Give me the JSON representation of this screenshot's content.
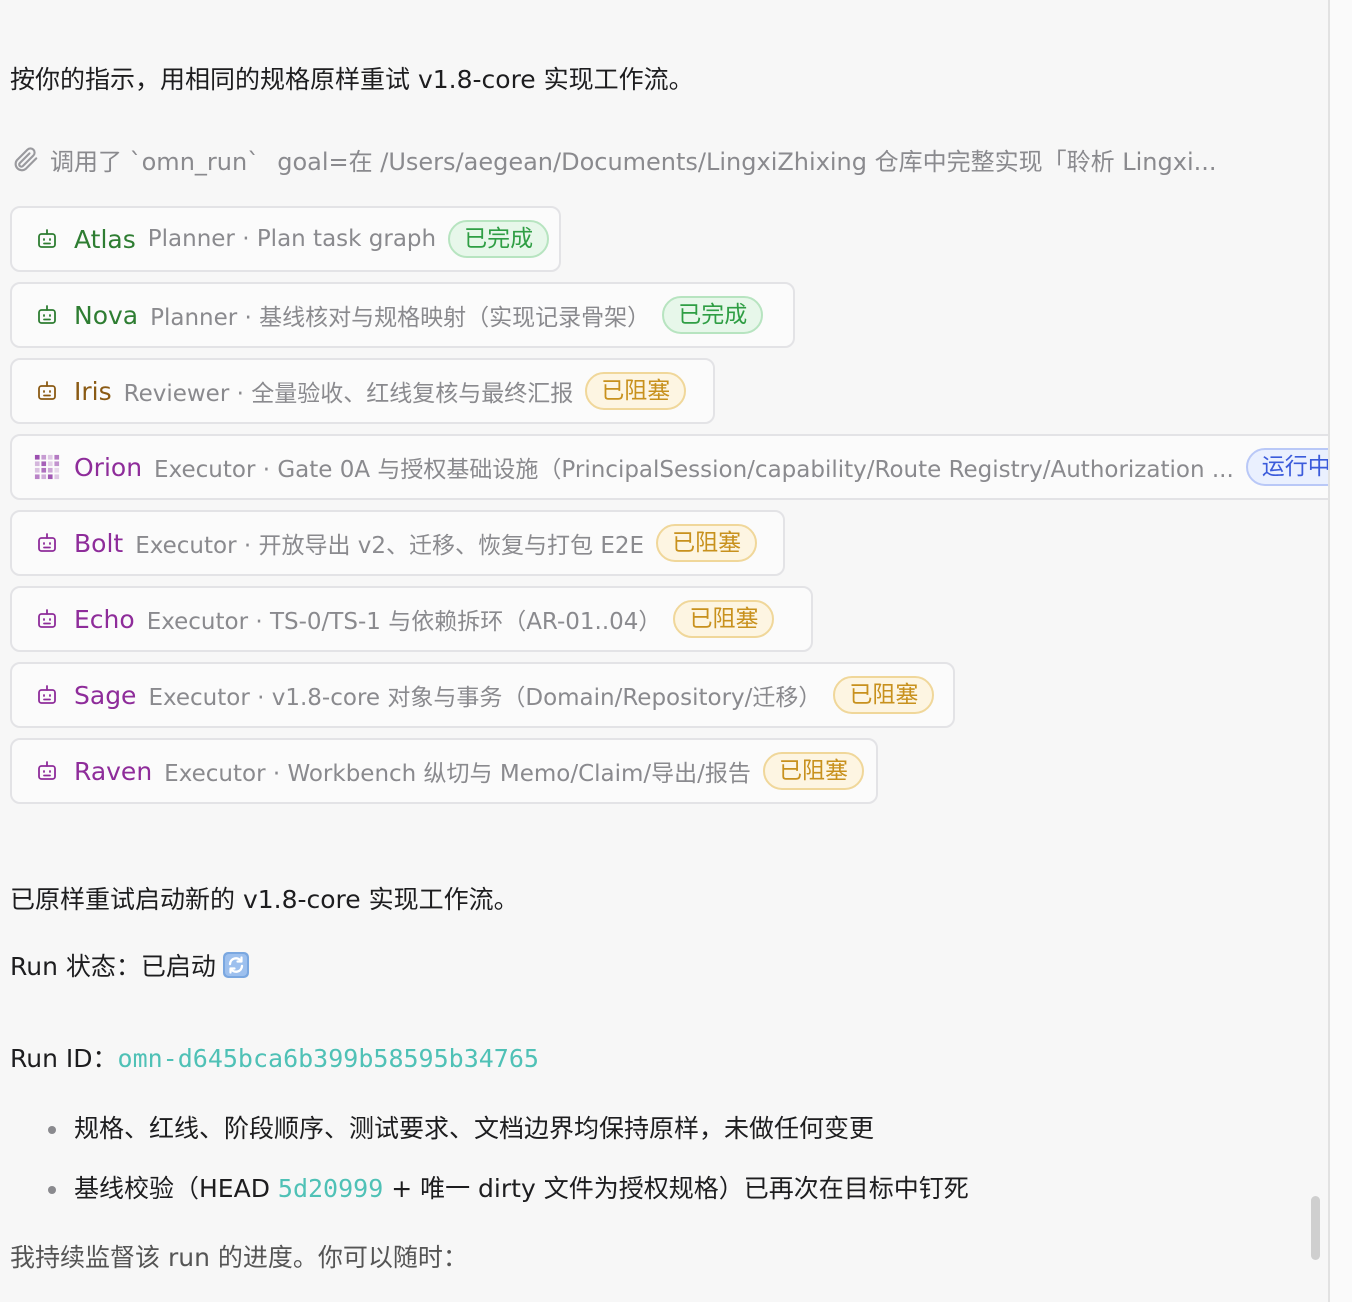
{
  "message": {
    "intro": "按你的指示，用相同的规格原样重试 v1.8-core 实现工作流。",
    "tool_call": {
      "label": "调用了 `omn_run`",
      "goal": "goal=在 /Users/aegean/Documents/LingxiZhixing 仓库中完整实现「聆析 Lingxi..."
    },
    "agents": [
      {
        "name": "Atlas",
        "desc": "Planner · Plan task graph",
        "status": "已完成",
        "state": "done",
        "color": "green",
        "icon": "robot-icon"
      },
      {
        "name": "Nova",
        "desc": "Planner · 基线核对与规格映射（实现记录骨架）",
        "status": "已完成",
        "state": "done",
        "color": "green",
        "icon": "robot-icon"
      },
      {
        "name": "Iris",
        "desc": "Reviewer · 全量验收、红线复核与最终汇报",
        "status": "已阻塞",
        "state": "blocked",
        "color": "brown",
        "icon": "robot-icon"
      },
      {
        "name": "Orion",
        "desc": "Executor · Gate 0A 与授权基础设施（PrincipalSession/capability/Route Registry/Authorization ...",
        "status": "运行中",
        "state": "running",
        "color": "purple",
        "icon": "loading-grid-icon"
      },
      {
        "name": "Bolt",
        "desc": "Executor · 开放导出 v2、迁移、恢复与打包 E2E",
        "status": "已阻塞",
        "state": "blocked",
        "color": "purple",
        "icon": "robot-icon"
      },
      {
        "name": "Echo",
        "desc": "Executor · TS-0/TS-1 与依赖拆环（AR-01..04）",
        "status": "已阻塞",
        "state": "blocked",
        "color": "purple",
        "icon": "robot-icon"
      },
      {
        "name": "Sage",
        "desc": "Executor · v1.8-core 对象与事务（Domain/Repository/迁移）",
        "status": "已阻塞",
        "state": "blocked",
        "color": "purple",
        "icon": "robot-icon"
      },
      {
        "name": "Raven",
        "desc": "Executor · Workbench 纵切与 Memo/Claim/导出/报告",
        "status": "已阻塞",
        "state": "blocked",
        "color": "purple",
        "icon": "robot-icon"
      }
    ],
    "restarted": "已原样重试启动新的 v1.8-core 实现工作流。",
    "run_status_label": "Run 状态：已启动",
    "run_id_label": "Run ID：",
    "run_id": "omn-d645bca6b399b58595b34765",
    "bullets": {
      "b1": "规格、红线、阶段顺序、测试要求、文档边界均保持原样，未做任何变更",
      "b2_pre": "基线校验（HEAD ",
      "b2_hash": "5d20999",
      "b2_post": " + 唯一 dirty 文件为授权规格）已再次在目标中钉死"
    },
    "monitor": "我持续监督该 run 的进度。你可以随时："
  },
  "colors": {
    "done": "#2f9e44",
    "blocked": "#c8911d",
    "running": "#3b5bdb",
    "accent_teal": "#4fc1b6"
  }
}
